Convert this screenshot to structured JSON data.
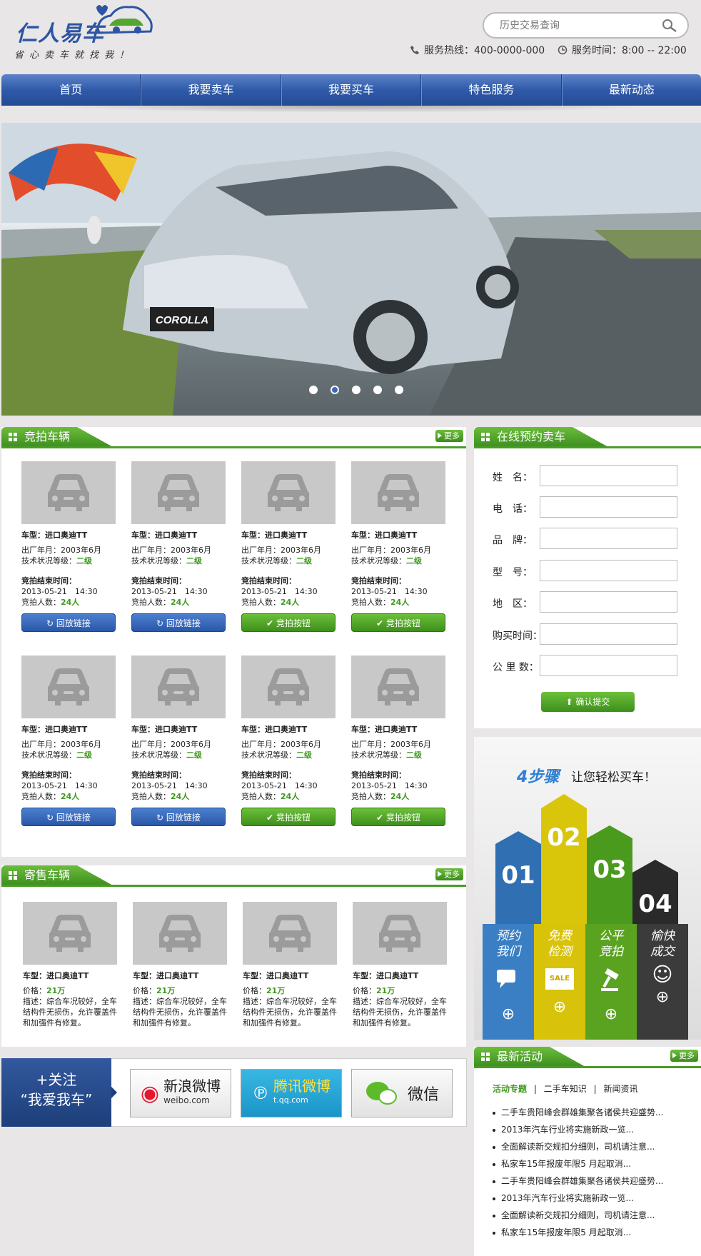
{
  "header": {
    "logo_main": "仁人易车",
    "slogan": "省心卖车就找我！",
    "search_placeholder": "历史交易查询",
    "hotline": "服务热线：400-0000-000",
    "service_time": "服务时间：8:00 -- 22:00"
  },
  "nav": [
    "首页",
    "我要卖车",
    "我要买车",
    "特色服务",
    "最新动态"
  ],
  "banner": {
    "brand_plate": "COROLLA",
    "active_dot": 2,
    "dot_count": 5
  },
  "auction": {
    "title": "竞拍车辆",
    "more": "更多",
    "model_label": "车型：",
    "model": "进口奥迪TT",
    "date_label": "出厂年月：",
    "date": "2003年6月",
    "grade_label": "技术状况等级：",
    "grade": "二级",
    "end_label": "竞拍结束时间：",
    "end_time": "2013-05-21　14:30",
    "count_label": "竞拍人数：",
    "count": "24人",
    "btn_replay": "回放链接",
    "btn_bid": "竞拍按钮"
  },
  "consign": {
    "title": "寄售车辆",
    "more": "更多",
    "model_label": "车型：",
    "model": "进口奥迪TT",
    "price_label": "价格：",
    "price": "21万",
    "desc": "描述：综合车况较好，全车结构件无损伤，允许覆盖件和加强件有修复。"
  },
  "booking": {
    "title": "在线预约卖车",
    "fields": [
      "姓　名：",
      "电　话：",
      "品　牌：",
      "型　号：",
      "地　区：",
      "购买时间：",
      "公 里 数："
    ],
    "submit": "确认提交"
  },
  "steps": {
    "title_num": "4步骤",
    "title_rest": "让您轻松买车！",
    "items": [
      {
        "num": "01",
        "label": "预约我们",
        "color": "#3a7fc4"
      },
      {
        "num": "02",
        "label": "免费检测",
        "color": "#d8c20a"
      },
      {
        "num": "03",
        "label": "公平竞拍",
        "color": "#5aa321"
      },
      {
        "num": "04",
        "label": "愉快成交",
        "color": "#3b3b3b"
      }
    ],
    "sale_tag": "SALE"
  },
  "social": {
    "follow_line1": "+关注",
    "follow_line2": "“我爱我车”",
    "weibo": "新浪微博",
    "weibo_sub": "weibo.com",
    "tqq": "腾讯微博",
    "tqq_sub": "t.qq.com",
    "wechat": "微信"
  },
  "news": {
    "title": "最新活动",
    "more": "更多",
    "tabs": [
      "活动专题",
      "二手车知识",
      "新闻资讯"
    ],
    "items": [
      "二手车贵阳峰会群雄集聚各诸侯共迎盛势...",
      "2013年汽车行业将实施新政一览...",
      "全面解读新交规扣分细则，司机请注意...",
      "私家车15年报废年限5 月起取消...",
      "二手车贵阳峰会群雄集聚各诸侯共迎盛势...",
      "2013年汽车行业将实施新政一览...",
      "全面解读新交规扣分细则，司机请注意...",
      "私家车15年报废年限5 月起取消..."
    ]
  }
}
